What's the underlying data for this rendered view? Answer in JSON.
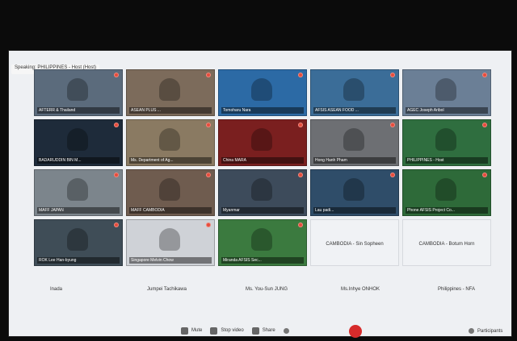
{
  "status": {
    "speaking": "Speaking: PHILIPPINES - Host (Host)"
  },
  "tiles": [
    {
      "label": "AFTERR & Thailand",
      "bg": "#5b6b7c",
      "name": "tile-afterr-thailand"
    },
    {
      "label": "ASEAN PLUS ...",
      "bg": "#7c6b5b",
      "name": "tile-asean-plus"
    },
    {
      "label": "Tomoharu Nara",
      "bg": "#2c6aa5",
      "name": "tile-tomoharu-nara"
    },
    {
      "label": "AFSIS ASEAN FOOD ...",
      "bg": "#3b6d98",
      "name": "tile-afsis-asean-food"
    },
    {
      "label": "AGEC Joseph Aribol",
      "bg": "#6b7f96",
      "name": "tile-agec-joseph"
    },
    {
      "label": "BADARUDDIN BIN M...",
      "bg": "#1e2b3a",
      "name": "tile-badaruddin"
    },
    {
      "label": "Ms. Department of Ag...",
      "bg": "#8a7a62",
      "name": "tile-department"
    },
    {
      "label": "China MARA",
      "bg": "#7a1f1f",
      "name": "tile-china-mara"
    },
    {
      "label": "Hong Hanh Pham",
      "bg": "#6d6f73",
      "name": "tile-hong-hanh-pham"
    },
    {
      "label": "PHILIPPINES - Host",
      "bg": "#2f6e3f",
      "name": "tile-philippines-host"
    },
    {
      "label": "MAFF JAPAN",
      "bg": "#7c858c",
      "name": "tile-maff-japan"
    },
    {
      "label": "MAFF CAMBODIA",
      "bg": "#6f5c4f",
      "name": "tile-maff-cambodia"
    },
    {
      "label": "Myanmar",
      "bg": "#3d4b5b",
      "name": "tile-myanmar"
    },
    {
      "label": "Lau padi...",
      "bg": "#2f4d69",
      "name": "tile-lau-padi"
    },
    {
      "label": "Phone AFSIS Project Co...",
      "bg": "#2e6a39",
      "name": "tile-afsis-project"
    },
    {
      "label": "ROK Lee Han-byung",
      "bg": "#3f4d57",
      "name": "tile-rok"
    },
    {
      "label": "Singapore Melvin Chow",
      "bg": "#cfd2d7",
      "name": "tile-singapore"
    },
    {
      "label": "Miranda AFSIS Sec...",
      "bg": "#3b7a3f",
      "name": "tile-afsis-sec"
    },
    {
      "label": "CAMBODIA - Sin Sopheen",
      "bg": "#f0f2f5",
      "name": "tile-cambodia-sin",
      "noimg": true
    },
    {
      "label": "CAMBODIA - Botum Horn",
      "bg": "#f0f2f5",
      "name": "tile-cambodia-botum",
      "noimg": true
    }
  ],
  "bottom_names": [
    "Inada",
    "Jumpei Tachikawa",
    "Ms. You-Sun JUNG",
    "Ms.Inhye ONHOK",
    "Philippines - NFA"
  ],
  "toolbar": {
    "mute": "Mute",
    "stop_video": "Stop video",
    "share": "Share",
    "participants": "Participants"
  },
  "colors": {
    "end_button": "#e23b3b"
  }
}
